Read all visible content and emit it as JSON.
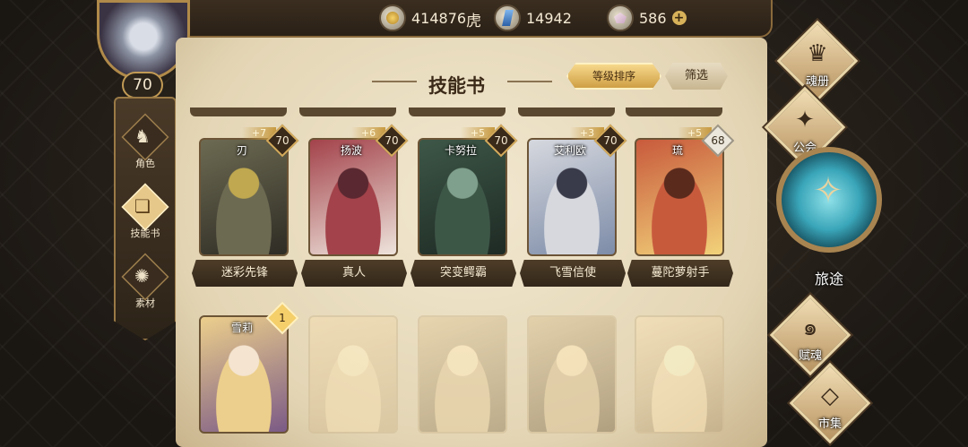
{
  "player": {
    "name": "虎",
    "level": "70"
  },
  "resources": {
    "gold": "414876",
    "crystal": "14942",
    "gem": "586",
    "gem_add": "+"
  },
  "panel": {
    "title": "技能书",
    "sort_label": "等级排序",
    "filter_label": "筛选"
  },
  "side_tabs": [
    {
      "label": "角色",
      "glyph": "♞"
    },
    {
      "label": "技能书",
      "glyph": "❏"
    },
    {
      "label": "素材",
      "glyph": "✺"
    }
  ],
  "cards": [
    {
      "char": "刃",
      "title": "迷彩先锋",
      "plus": "+7",
      "level": "70",
      "palette": [
        "#6d6a52",
        "#2e2c24",
        "#bfa84f"
      ]
    },
    {
      "char": "扬波",
      "title": "真人",
      "plus": "+6",
      "level": "70",
      "palette": [
        "#a3424a",
        "#eee4dc",
        "#5a2830"
      ]
    },
    {
      "char": "卡努拉",
      "title": "突变鳄霸",
      "plus": "+5",
      "level": "70",
      "palette": [
        "#3d5747",
        "#1e2a24",
        "#7fa08c"
      ]
    },
    {
      "char": "艾利欧",
      "title": "飞雪信使",
      "plus": "+3",
      "level": "70",
      "palette": [
        "#d6d8de",
        "#7d8ca8",
        "#3a3b4a"
      ]
    },
    {
      "char": "琉",
      "title": "蔓陀萝射手",
      "plus": "+5",
      "level": "68",
      "palette": [
        "#c85a3c",
        "#f2d27a",
        "#5a2a1c"
      ]
    },
    {
      "char": "雪莉",
      "title": "",
      "plus": "",
      "level": "1",
      "palette": [
        "#eccf8c",
        "#7b5a86",
        "#f4e4d0"
      ]
    },
    {
      "char": "",
      "title": "",
      "plus": "",
      "level": "",
      "palette": [
        "#d3c6a6",
        "#b8a886",
        "#e2d7bc"
      ]
    },
    {
      "char": "",
      "title": "",
      "plus": "",
      "level": "",
      "palette": [
        "#c9b890",
        "#8c7b5a",
        "#e0d3b3"
      ]
    },
    {
      "char": "",
      "title": "",
      "plus": "",
      "level": "",
      "palette": [
        "#c4b089",
        "#7e6a4c",
        "#ddcfae"
      ]
    },
    {
      "char": "",
      "title": "",
      "plus": "",
      "level": "",
      "palette": [
        "#d7cbae",
        "#a79777",
        "#e9e0c9"
      ]
    }
  ],
  "right_menu": {
    "soul_book": "魂册",
    "guild": "公会",
    "journey": "旅途",
    "talent": "赋魂",
    "market": "市集"
  },
  "icons": {
    "gold": "coin-icon",
    "crystal": "crystal-icon",
    "gem": "gem-icon"
  }
}
